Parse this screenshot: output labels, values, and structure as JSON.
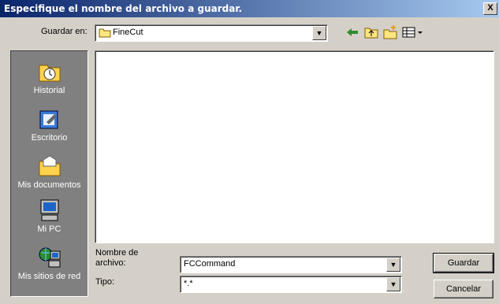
{
  "window": {
    "title": "Especifique el nombre del archivo a guardar.",
    "close": "X"
  },
  "look_in": {
    "label": "Guardar en:",
    "value": "FineCut"
  },
  "toolbar": {
    "icons": [
      "back-icon",
      "up-folder-icon",
      "new-folder-icon",
      "view-menu-icon"
    ]
  },
  "places": [
    {
      "label": "Historial"
    },
    {
      "label": "Escritorio"
    },
    {
      "label": "Mis documentos"
    },
    {
      "label": "Mi PC"
    },
    {
      "label": "Mis sitios de red"
    }
  ],
  "filename": {
    "label": "Nombre de archivo:",
    "value": "FCCommand"
  },
  "filetype": {
    "label": "Tipo:",
    "value": "*.*"
  },
  "buttons": {
    "save": "Guardar",
    "cancel": "Cancelar"
  }
}
